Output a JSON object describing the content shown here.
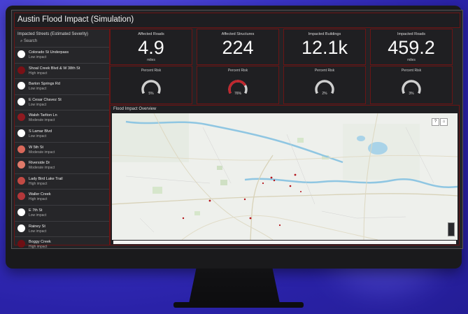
{
  "dashboard": {
    "title": "Austin Flood Impact (Simulation)"
  },
  "sidebar": {
    "header": "Impacted Streets (Estimated Severity)",
    "search_placeholder": "Search",
    "items": [
      {
        "line1": "Colorado St Underpass",
        "line2": "Low impact",
        "color": "#ffffff"
      },
      {
        "line1": "Shoal Creek Blvd & W 38th St",
        "line2": "High impact",
        "color": "#7a1116"
      },
      {
        "line1": "Barton Springs Rd",
        "line2": "Low impact",
        "color": "#ffffff"
      },
      {
        "line1": "E Cesar Chavez St",
        "line2": "Low impact",
        "color": "#ffffff"
      },
      {
        "line1": "Walsh Tarlton Ln",
        "line2": "Moderate impact",
        "color": "#8f1a20"
      },
      {
        "line1": "S Lamar Blvd",
        "line2": "Low impact",
        "color": "#ffffff"
      },
      {
        "line1": "W 5th St",
        "line2": "Moderate impact",
        "color": "#d9685a"
      },
      {
        "line1": "Riverside Dr",
        "line2": "Moderate impact",
        "color": "#e07a6a"
      },
      {
        "line1": "Lady Bird Lake Trail",
        "line2": "High impact",
        "color": "#c24a44"
      },
      {
        "line1": "Waller Creek",
        "line2": "High impact",
        "color": "#b3373a"
      },
      {
        "line1": "E 7th St",
        "line2": "Low impact",
        "color": "#ffffff"
      },
      {
        "line1": "Rainey St",
        "line2": "Low impact",
        "color": "#ffffff"
      },
      {
        "line1": "Boggy Creek",
        "line2": "High impact",
        "color": "#6e0f14"
      }
    ]
  },
  "stats": [
    {
      "label": "Affected Roads",
      "value": "4.9",
      "unit": "miles"
    },
    {
      "label": "Affected Structures",
      "value": "224",
      "unit": ""
    },
    {
      "label": "Impacted Buildings",
      "value": "12.1k",
      "unit": ""
    },
    {
      "label": "Impacted Roads",
      "value": "459.2",
      "unit": "miles"
    }
  ],
  "gauges": [
    {
      "label": "Percent Risk",
      "text": "5%",
      "level": 0.05,
      "color": "#cfcfcf"
    },
    {
      "label": "Percent Risk",
      "text": "76%",
      "level": 0.76,
      "color": "#c0262d"
    },
    {
      "label": "Percent Risk",
      "text": "2%",
      "level": 0.02,
      "color": "#cfcfcf"
    },
    {
      "label": "Percent Risk",
      "text": "3%",
      "level": 0.03,
      "color": "#cfcfcf"
    }
  ],
  "map": {
    "label": "Flood Impact Overview",
    "buttons": [
      "?",
      "⌂"
    ]
  }
}
